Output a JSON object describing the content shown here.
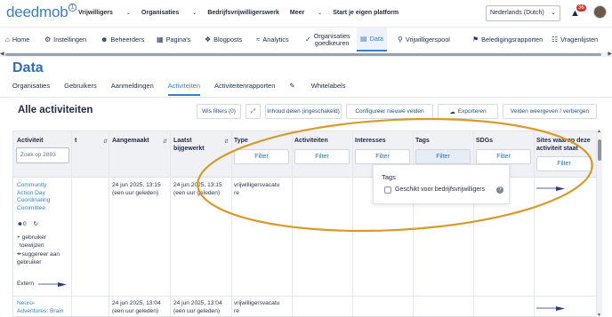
{
  "topbar": {
    "logo": "deedmob",
    "nav": [
      {
        "label": "Vrijwilligers",
        "chevron": true
      },
      {
        "label": "Organisaties",
        "chevron": true
      },
      {
        "label": "Bedrijfsvrijwilligerswerk",
        "chevron": false
      },
      {
        "label": "Meer",
        "chevron": true
      },
      {
        "label": "Start je eigen platform",
        "chevron": false
      }
    ],
    "language": "Nederlands (Dutch)",
    "notifications": "36"
  },
  "adminnav": {
    "home": "Home",
    "instellingen": "Instellingen",
    "beheerders": "Beheerders",
    "paginas": "Pagina's",
    "blogposts": "Blogposts",
    "analytics": "Analytics",
    "org_line1": "Organisaties",
    "org_line2": "goedkeuren",
    "data": "Data",
    "vrijwilligerspool": "Vrijwilligerspool",
    "beledigingsrapporten": "Beledigingsrapporten",
    "vragenlijsten": "Vragenlijsten"
  },
  "page": {
    "title": "Data",
    "section_title": "Alle activiteiten"
  },
  "tabs": {
    "organisaties": "Organisaties",
    "gebruikers": "Gebruikers",
    "aanmeldingen": "Aanmeldingen",
    "activiteiten": "Activiteiten",
    "activiteitenrapporten": "Activiteitenrapporten",
    "whitelabels": "Whitelabels"
  },
  "toolbar": {
    "wis_filters": "Wis filters (0)",
    "inhoud_delen": "Inhoud delen (ingeschakeld)",
    "configureer": "Configureer nieuwe velden",
    "exporteren": "Exporteren",
    "velden": "Velden weergeven / verbergen"
  },
  "table": {
    "headers": {
      "activiteit": "Activiteit",
      "hidden_col": "t",
      "aangemaakt": "Aangemaakt",
      "laatst1": "Laatst",
      "laatst2": "bijgewerkt",
      "type": "Type",
      "activiteiten": "Activiteiten",
      "interesses": "Interesses",
      "tags": "Tags",
      "sdgs": "SDGs",
      "sites1": "Sites waarop deze",
      "sites2": "activiteit staat"
    },
    "search_placeholder": "Zoek op 2893",
    "filter_label": "Filter",
    "rows": [
      {
        "title_lines": [
          "Community",
          "Action Day",
          "Coordinating",
          "Committee"
        ],
        "count": "0",
        "assign": [
          "+ gebruiker",
          "toewijzen"
        ],
        "suggest": [
          "suggereer aan",
          "gebruiker"
        ],
        "extern": "Extern",
        "created": "24 jun 2025, 13:15",
        "created_rel": "(een uur geleden)",
        "updated": "24 jun 2025, 13:15",
        "updated_rel": "(een uur geleden)",
        "type_lines": [
          "vrijwilligersvacatu",
          "re"
        ]
      },
      {
        "title_lines": [
          "Neuro-",
          "Adventures: Brain"
        ],
        "created": "24 jun 2025, 13:04",
        "created_rel": "(een uur geleden)",
        "updated": "24 jun 2025, 13:04",
        "updated_rel": "(een uur geleden)",
        "type_lines": [
          "vrijwilligersvacatu",
          "re"
        ]
      }
    ]
  },
  "dropdown": {
    "title": "Tags",
    "option": "Geschikt voor bedrijfsvrijwilligers",
    "checked": false
  },
  "colors": {
    "accent": "#3a7fc6",
    "annotation_ellipse": "#d99a2b",
    "badge": "#d0352f"
  }
}
